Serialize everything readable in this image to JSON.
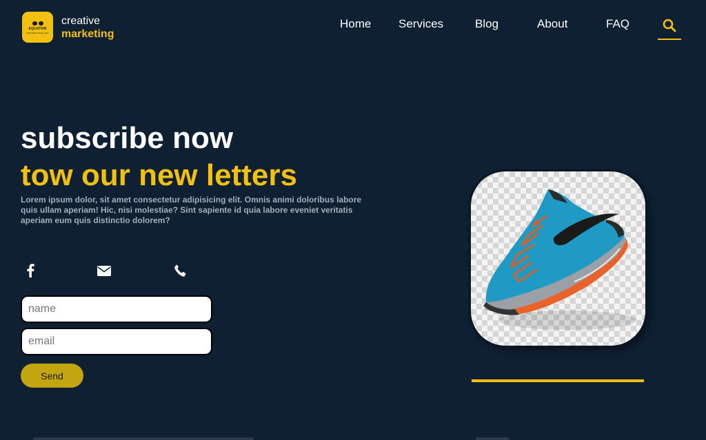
{
  "logo": {
    "text": "EQUATOR",
    "subtext": "EYEWEAR SINCE 2021"
  },
  "brand": {
    "top": "creative",
    "bottom": "marketing"
  },
  "nav": {
    "home": "Home",
    "services": "Services",
    "blog": "Blog",
    "about": "About",
    "faq": "FAQ"
  },
  "hero": {
    "headline1": "subscribe now",
    "headline2": "tow our new letters",
    "body": "Lorem ipsum dolor, sit amet consectetur adipisicing elit. Omnis animi doloribus labore quis ullam aperiam! Hic, nisi molestiae? Sint sapiente id quia labore eveniet veritatis aperiam eum quis distinctio dolorem?"
  },
  "social": {
    "icons": [
      "facebook-icon",
      "mail-icon",
      "phone-icon"
    ]
  },
  "form": {
    "name_placeholder": "name",
    "email_placeholder": "email",
    "send_label": "Send"
  },
  "colors": {
    "background": "#0f2033",
    "accent": "#f2c10f",
    "button": "#c3a512"
  }
}
